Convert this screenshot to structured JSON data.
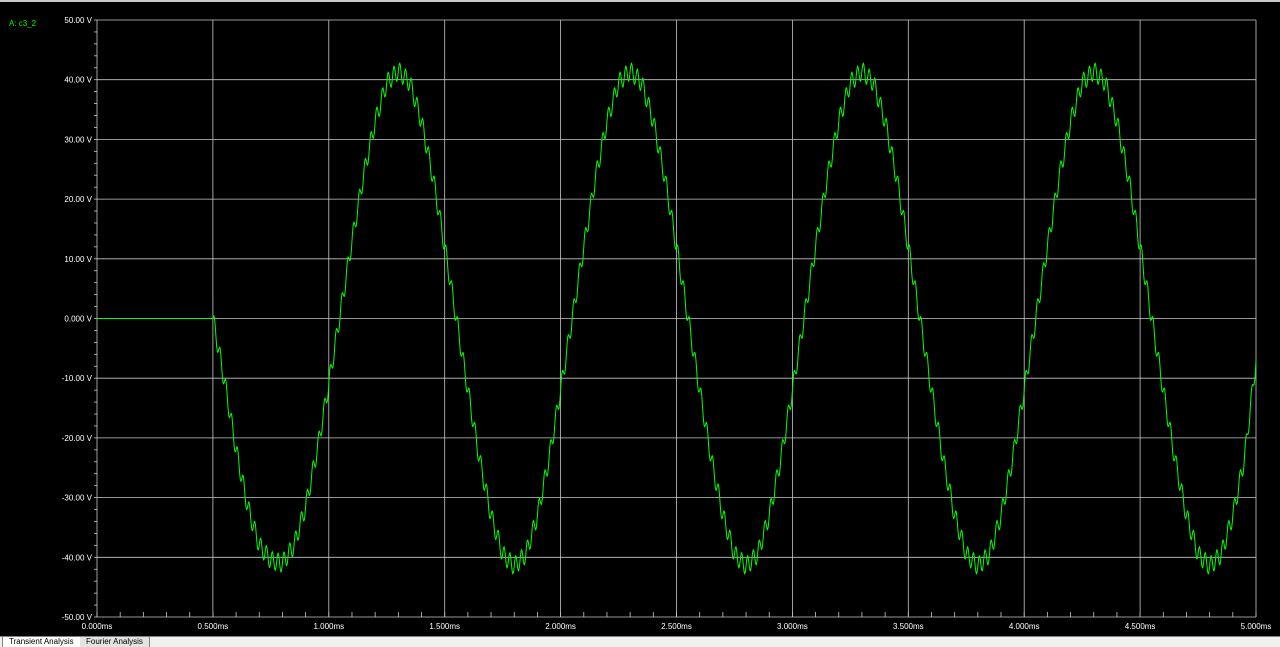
{
  "trace_label": "A: c3_2",
  "tabs": [
    {
      "label": "Transient Analysis",
      "active": true
    },
    {
      "label": "Fourier Analysis",
      "active": false
    }
  ],
  "colors": {
    "background": "#000000",
    "trace": "#00ff00",
    "grid": "#c8c8c8",
    "text": "#ffffff"
  },
  "chart_data": {
    "type": "line",
    "title": "",
    "xlabel": "",
    "ylabel": "",
    "grid": true,
    "xlim": [
      0.0,
      5.0
    ],
    "ylim": [
      -50,
      50
    ],
    "x_ticks": [
      "0.000ms",
      "0.500ms",
      "1.000ms",
      "1.500ms",
      "2.000ms",
      "2.500ms",
      "3.000ms",
      "3.500ms",
      "4.000ms",
      "4.500ms",
      "5.000ms"
    ],
    "y_ticks": [
      "50.00 V",
      "40.00 V",
      "30.00 V",
      "20.00 V",
      "10.00 V",
      "0.000 V",
      "-10.00 V",
      "-20.00 V",
      "-30.00 V",
      "-40.00 V",
      "-50.00 V"
    ],
    "series": [
      {
        "name": "c3_2",
        "x": [
          0.0,
          0.5,
          0.55,
          0.6,
          0.65,
          0.7,
          0.75,
          0.8,
          0.85,
          0.9,
          0.95,
          1.0,
          1.05,
          1.1,
          1.15,
          1.2,
          1.25,
          1.3,
          1.35,
          1.4,
          1.45,
          1.5,
          1.55,
          1.6,
          1.65,
          1.7,
          1.75,
          1.8,
          1.85,
          1.9,
          1.95,
          2.0,
          2.05,
          2.1,
          2.15,
          2.2,
          2.25,
          2.3,
          2.35,
          2.4,
          2.45,
          2.5,
          2.55,
          2.6,
          2.65,
          2.7,
          2.75,
          2.8,
          2.85,
          2.9,
          2.95,
          3.0,
          3.05,
          3.1,
          3.15,
          3.2,
          3.25,
          3.3,
          3.35,
          3.4,
          3.45,
          3.5,
          3.55,
          3.6,
          3.65,
          3.7,
          3.75,
          3.8,
          3.85,
          3.9,
          3.95,
          4.0,
          4.05,
          4.1,
          4.15,
          4.2,
          4.25,
          4.3,
          4.35,
          4.4,
          4.45,
          4.5,
          4.55,
          4.6,
          4.65,
          4.7,
          4.75,
          4.8,
          4.85,
          4.9,
          4.95,
          5.0
        ],
        "y": [
          0.0,
          0.0,
          -10.5,
          -22.0,
          -31.5,
          -38.0,
          -40.5,
          -41.0,
          -38.0,
          -31.5,
          -22.0,
          -11.0,
          1.0,
          13.0,
          24.0,
          33.0,
          39.5,
          41.5,
          39.5,
          33.0,
          23.5,
          12.0,
          0.0,
          -12.0,
          -23.5,
          -33.0,
          -39.5,
          -41.5,
          -39.5,
          -33.0,
          -23.5,
          -12.0,
          0.0,
          12.0,
          23.5,
          33.0,
          39.5,
          41.5,
          39.5,
          33.0,
          23.5,
          12.0,
          0.0,
          -12.0,
          -23.5,
          -33.0,
          -39.5,
          -41.5,
          -39.5,
          -33.0,
          -23.5,
          -12.0,
          0.0,
          12.0,
          23.5,
          33.0,
          39.5,
          41.5,
          39.5,
          33.0,
          23.5,
          12.0,
          0.0,
          -12.0,
          -23.5,
          -33.0,
          -39.5,
          -41.5,
          -39.5,
          -33.0,
          -23.5,
          -12.0,
          0.0,
          12.0,
          23.5,
          33.0,
          39.5,
          41.5,
          39.5,
          33.0,
          23.5,
          12.0,
          0.0,
          -12.0,
          -23.5,
          -33.0,
          -39.5,
          -41.5,
          -39.5,
          -33.0,
          -23.5,
          -7.0
        ]
      }
    ]
  }
}
